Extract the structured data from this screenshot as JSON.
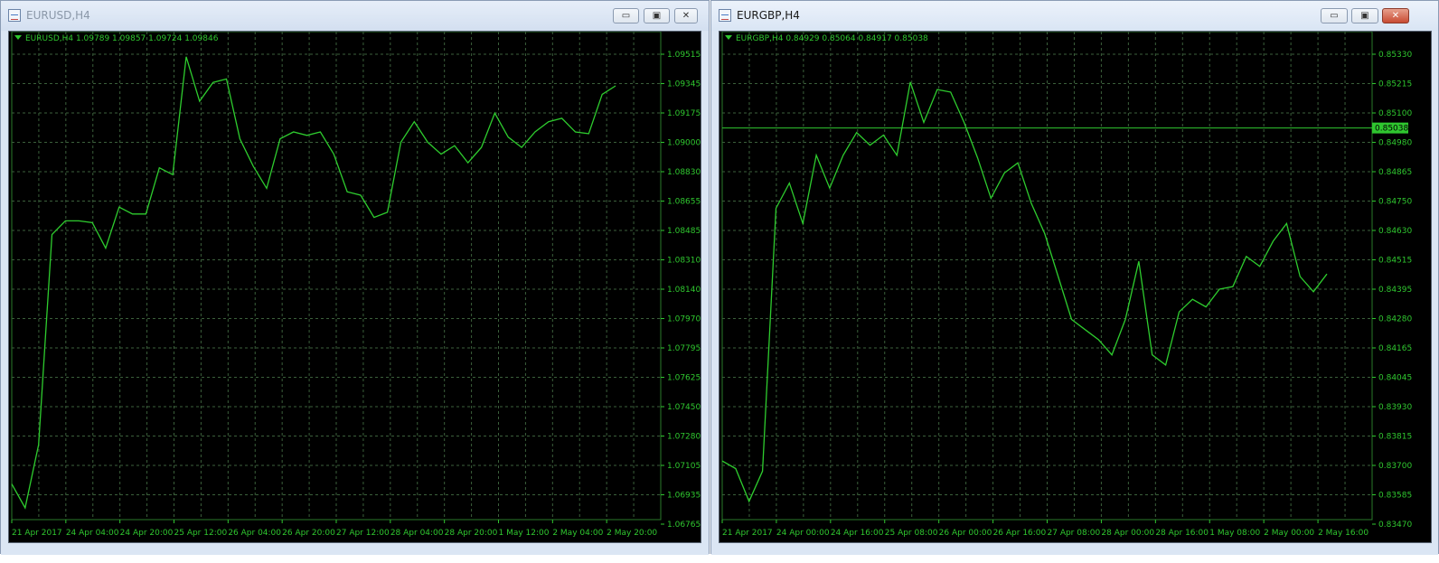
{
  "windows": [
    {
      "title": "EURUSD,H4",
      "info": "EURUSD,H4  1.09789 1.09857 1.09724 1.09846",
      "controls": {
        "minimize": "▭",
        "maximize": "▣",
        "close": "✕"
      },
      "chart_data": {
        "type": "line",
        "symbol": "EURUSD",
        "timeframe": "H4",
        "y_ticks": [
          "1.09515",
          "1.09345",
          "1.09175",
          "1.09000",
          "1.08830",
          "1.08655",
          "1.08485",
          "1.08310",
          "1.08140",
          "1.07970",
          "1.07795",
          "1.07625",
          "1.07450",
          "1.07280",
          "1.07105",
          "1.06935",
          "1.06765"
        ],
        "x_ticks": [
          "21 Apr 2017",
          "24 Apr 04:00",
          "24 Apr 20:00",
          "25 Apr 12:00",
          "26 Apr 04:00",
          "26 Apr 20:00",
          "27 Apr 12:00",
          "28 Apr 04:00",
          "28 Apr 20:00",
          "1 May 12:00",
          "2 May 04:00",
          "2 May 20:00"
        ],
        "ylim": [
          1.06765,
          1.09515
        ],
        "values": [
          1.07,
          1.0686,
          1.0723,
          1.0846,
          1.0854,
          1.0854,
          1.0853,
          1.0838,
          1.0862,
          1.0858,
          1.0858,
          1.0885,
          1.0881,
          1.095,
          1.0924,
          1.0935,
          1.0937,
          1.0902,
          1.0886,
          1.0873,
          1.0902,
          1.0906,
          1.0904,
          1.0906,
          1.0893,
          1.0871,
          1.0869,
          1.0856,
          1.0859,
          1.09,
          1.0912,
          1.09,
          1.0893,
          1.0898,
          1.0888,
          1.0897,
          1.0917,
          1.0903,
          1.0897,
          1.0906,
          1.0912,
          1.0914,
          1.0906,
          1.0905,
          1.0928,
          1.0933
        ]
      }
    },
    {
      "title": "EURGBP,H4",
      "info": "EURGBP,H4  0.84929 0.85064 0.84917 0.85038",
      "controls": {
        "minimize": "▭",
        "maximize": "▣",
        "close": "✕"
      },
      "chart_data": {
        "type": "line",
        "symbol": "EURGBP",
        "timeframe": "H4",
        "y_ticks": [
          "0.85330",
          "0.85215",
          "0.85100",
          "0.84980",
          "0.84865",
          "0.84750",
          "0.84630",
          "0.84515",
          "0.84395",
          "0.84280",
          "0.84165",
          "0.84045",
          "0.83930",
          "0.83815",
          "0.83700",
          "0.83585",
          "0.83470"
        ],
        "x_ticks": [
          "21 Apr 2017",
          "24 Apr 00:00",
          "24 Apr 16:00",
          "25 Apr 08:00",
          "26 Apr 00:00",
          "26 Apr 16:00",
          "27 Apr 08:00",
          "28 Apr 00:00",
          "28 Apr 16:00",
          "1 May 08:00",
          "2 May 00:00",
          "2 May 16:00"
        ],
        "ylim": [
          0.8347,
          0.8533
        ],
        "current_price": "0.85038",
        "values": [
          0.8372,
          0.8369,
          0.8356,
          0.8368,
          0.8472,
          0.8482,
          0.8466,
          0.8493,
          0.848,
          0.8493,
          0.8502,
          0.8497,
          0.8501,
          0.8493,
          0.8522,
          0.8506,
          0.8519,
          0.8518,
          0.8506,
          0.8492,
          0.8476,
          0.8486,
          0.849,
          0.8474,
          0.8462,
          0.8445,
          0.8428,
          0.8424,
          0.842,
          0.8414,
          0.8428,
          0.8451,
          0.8414,
          0.841,
          0.8431,
          0.8436,
          0.8433,
          0.844,
          0.8441,
          0.8453,
          0.8449,
          0.8459,
          0.8466,
          0.8445,
          0.8439,
          0.8446
        ]
      }
    }
  ]
}
